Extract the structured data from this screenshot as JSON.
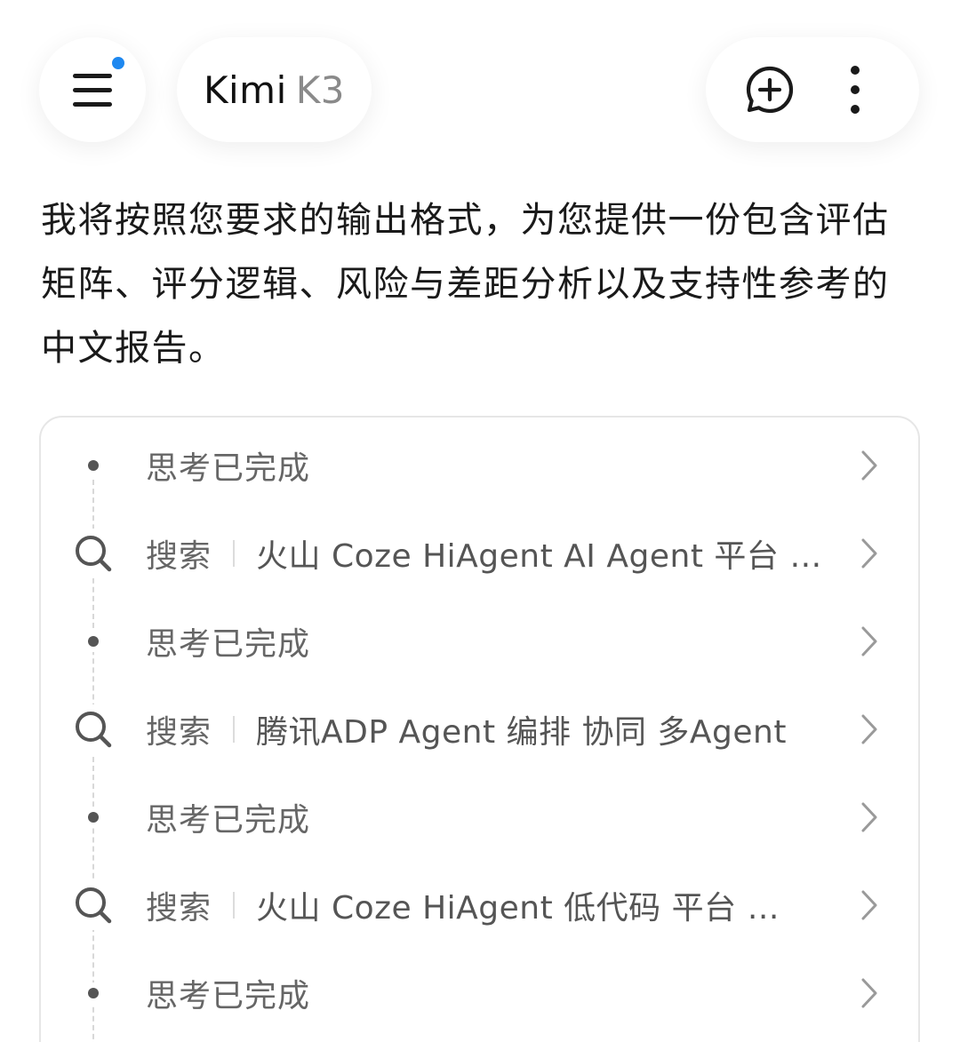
{
  "header": {
    "app_name": "Kimi",
    "model": "K3",
    "menu_icon": "hamburger-menu-icon",
    "new_chat_icon": "chat-plus-icon",
    "more_icon": "more-vertical-icon",
    "notification_color": "#1e88f0"
  },
  "message": {
    "intro": "我将按照您要求的输出格式，为您提供一份包含评估矩阵、评分逻辑、风险与差距分析以及支持性参考的中文报告。"
  },
  "steps": [
    {
      "type": "thinking",
      "label": "思考已完成"
    },
    {
      "type": "search",
      "label": "搜索",
      "query": "火山 Coze HiAgent AI Agent 平台 介绍"
    },
    {
      "type": "thinking",
      "label": "思考已完成"
    },
    {
      "type": "search",
      "label": "搜索",
      "query": "腾讯ADP Agent 编排 协同 多Agent"
    },
    {
      "type": "thinking",
      "label": "思考已完成"
    },
    {
      "type": "search",
      "label": "搜索",
      "query": "火山 Coze HiAgent 低代码 平台 介绍"
    },
    {
      "type": "thinking",
      "label": "思考已完成"
    }
  ]
}
